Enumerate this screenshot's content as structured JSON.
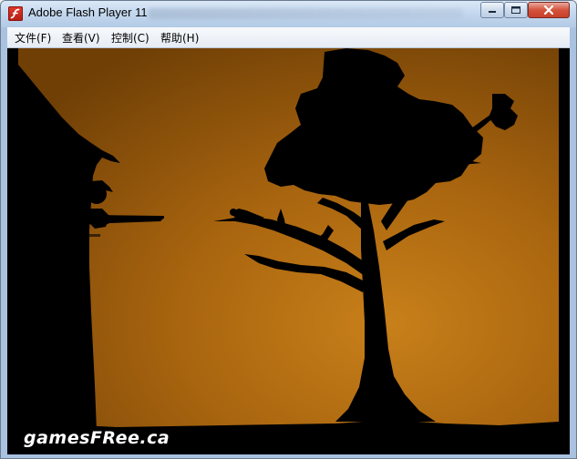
{
  "window": {
    "title": "Adobe Flash Player 11",
    "icon": "flash-player-icon"
  },
  "menu": {
    "items": [
      "文件(F)",
      "查看(V)",
      "控制(C)",
      "帮助(H)"
    ]
  },
  "game": {
    "scene": "sunset-silhouette-hunt",
    "logo_text": "gamesFRee.ca",
    "sky_color": "#c07a14",
    "silhouette_color": "#000000"
  }
}
